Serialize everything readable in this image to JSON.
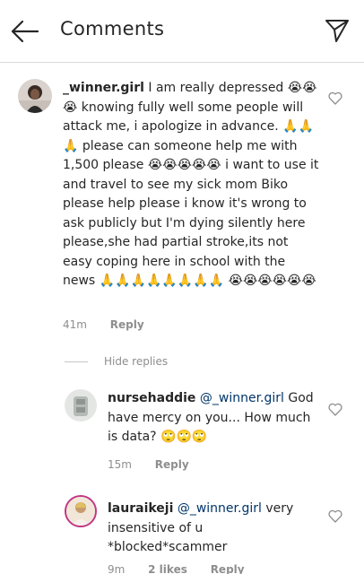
{
  "header": {
    "title": "Comments",
    "back_icon": "arrow-left-icon",
    "share_icon": "paper-plane-icon"
  },
  "comments": [
    {
      "username": "_winner.girl",
      "text": "I am really depressed 😭😭😭 knowing fully well some people will attack me, i apologize in advance. 🙏🙏🙏 please can someone help me with 1,500 please 😭😭😭😭😭 i want to use it and travel to see my sick mom Biko please help please i know it's wrong to ask publicly but I'm dying silently here please,she had partial stroke,its not easy coping here in school with the news 🙏🙏🙏🙏🙏🙏🙏🙏 😭😭😭😭😭😭",
      "time": "41m",
      "reply_label": "Reply"
    }
  ],
  "hide_replies_label": "Hide replies",
  "replies": [
    {
      "username": "nursehaddie",
      "mention": "@_winner.girl",
      "text": "God have mercy on you... How  much is data? 🙄🙄🙄",
      "time": "15m",
      "reply_label": "Reply"
    },
    {
      "username": "lauraikeji",
      "mention": "@_winner.girl",
      "text": "very insensitive of u *blocked*scammer",
      "time": "9m",
      "likes": "2 likes",
      "reply_label": "Reply"
    }
  ],
  "colors": {
    "text": "#262626",
    "meta": "#8e8e8e",
    "mention": "#003569",
    "divider": "#dbdbdb"
  }
}
